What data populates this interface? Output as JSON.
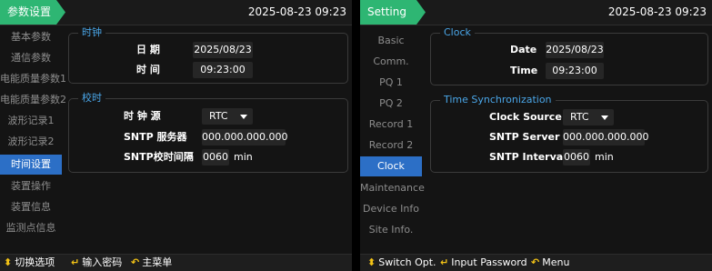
{
  "left": {
    "tab_label": "参数设置",
    "datetime": "2025-08-23 09:23",
    "sidebar": [
      "基本参数",
      "通信参数",
      "电能质量参数1",
      "电能质量参数2",
      "波形记录1",
      "波形记录2",
      "时间设置",
      "装置操作",
      "装置信息",
      "监测点信息"
    ],
    "active_index": 6,
    "clock": {
      "title": "时钟",
      "date_label": "日  期",
      "date_value": "2025/08/23",
      "time_label": "时  间",
      "time_value": "09:23:00"
    },
    "sync": {
      "title": "校时",
      "source_label": "时     钟     源",
      "source_value": "RTC",
      "sntp_label": "SNTP  服务器",
      "sntp_value": "000.000.000.000",
      "interval_label": "SNTP校时间隔",
      "interval_value": "0060",
      "interval_unit": "min"
    },
    "footer": {
      "switch": "切换选项",
      "password": "输入密码",
      "menu": "主菜单"
    }
  },
  "right": {
    "tab_label": "Setting",
    "datetime": "2025-08-23 09:23",
    "sidebar": [
      "Basic",
      "Comm.",
      "PQ 1",
      "PQ 2",
      "Record 1",
      "Record 2",
      "Clock",
      "Maintenance",
      "Device Info",
      "Site Info."
    ],
    "active_index": 6,
    "clock": {
      "title": "Clock",
      "date_label": "Date",
      "date_value": "2025/08/23",
      "time_label": "Time",
      "time_value": "09:23:00"
    },
    "sync": {
      "title": "Time Synchronization",
      "source_label": "Clock Source",
      "source_value": "RTC",
      "sntp_label": "SNTP Server IP",
      "sntp_value": "000.000.000.000",
      "interval_label": "SNTP Interval",
      "interval_value": "0060",
      "interval_unit": "min"
    },
    "footer": {
      "switch": "Switch Opt.",
      "password": "Input Password",
      "menu": "Menu"
    }
  },
  "colors": {
    "accent_green": "#2eb673",
    "active_blue": "#2c6fc6",
    "group_title": "#4aa6e8",
    "footer_icon": "#f3c316"
  },
  "icons": {
    "switch": "up-down-arrows-icon",
    "password": "enter-return-icon",
    "menu": "back-arrow-icon"
  }
}
